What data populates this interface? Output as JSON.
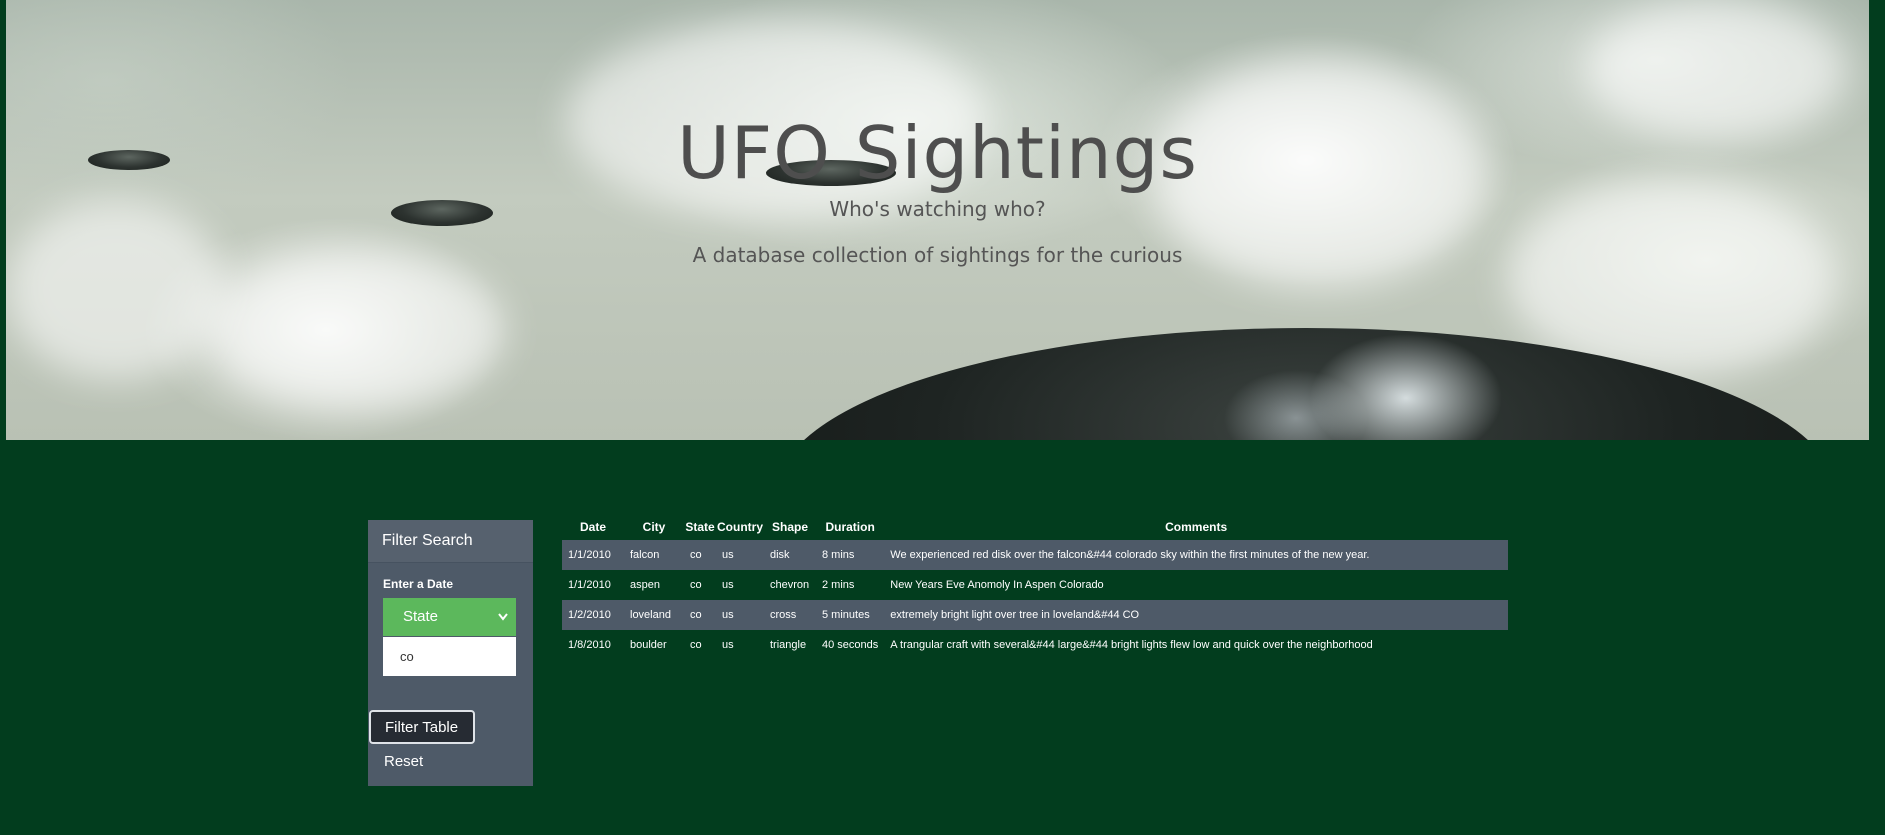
{
  "hero": {
    "title": "UFO Sightings",
    "subtitle": "Who's watching who?",
    "tagline": "A database collection of sightings for the curious"
  },
  "filter": {
    "heading": "Filter Search",
    "date_label": "Enter a Date",
    "select_value": "State",
    "input_value": "co",
    "filter_button": "Filter Table",
    "reset_button": "Reset",
    "colors": {
      "select": "#5cb85c",
      "panel": "#4e5a68",
      "button": "#262b33"
    }
  },
  "table": {
    "headers": [
      "Date",
      "City",
      "State",
      "Country",
      "Shape",
      "Duration",
      "Comments"
    ],
    "rows": [
      [
        "1/1/2010",
        "falcon",
        "co",
        "us",
        "disk",
        "8 mins",
        "We experienced red disk over the falcon&#44 colorado sky within the first minutes of the new year."
      ],
      [
        "1/1/2010",
        "aspen",
        "co",
        "us",
        "chevron",
        "2 mins",
        "New Years Eve Anomoly In Aspen Colorado"
      ],
      [
        "1/2/2010",
        "loveland",
        "co",
        "us",
        "cross",
        "5 minutes",
        "extremely bright light over tree in loveland&#44 CO"
      ],
      [
        "1/8/2010",
        "boulder",
        "co",
        "us",
        "triangle",
        "40 seconds",
        "A trangular craft with several&#44 large&#44 bright lights flew low and quick over the neighborhood"
      ]
    ]
  },
  "page": {
    "background": "#023d1e"
  }
}
